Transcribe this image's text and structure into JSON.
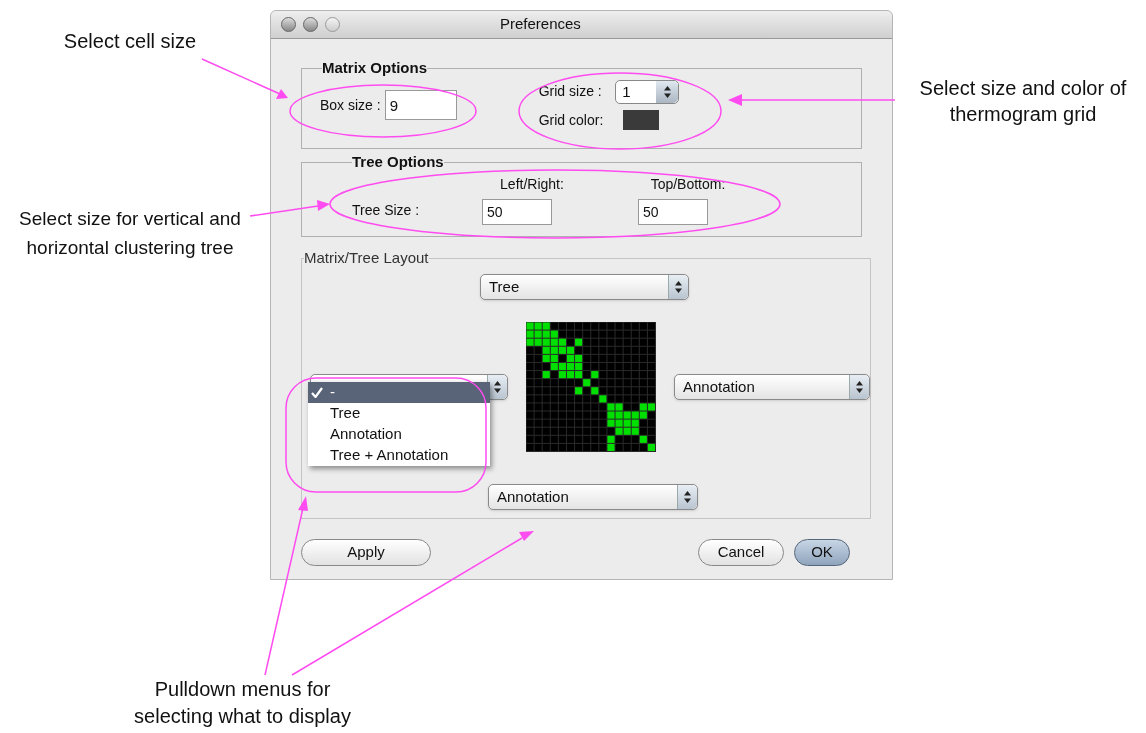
{
  "annotations": [
    {
      "text": "Select cell size"
    },
    {
      "text": "Select size and color of thermogram grid"
    },
    {
      "text": "Select size for vertical and horizontal clustering tree"
    },
    {
      "text": "Pulldown menus for selecting what to display"
    }
  ],
  "window": {
    "title": "Preferences"
  },
  "matrix_options": {
    "title": "Matrix Options",
    "box_size": {
      "label": "Box size :",
      "value": "9"
    },
    "grid_size": {
      "label": "Grid size :",
      "value": "1"
    },
    "grid_color": {
      "label": "Grid color:",
      "color": "#3a3a3a"
    }
  },
  "tree_options": {
    "title": "Tree Options",
    "row_label": "Tree Size :",
    "fields": [
      {
        "label": "Left/Right:",
        "value": "50"
      },
      {
        "label": "Top/Bottom:",
        "value": "50"
      }
    ]
  },
  "layout": {
    "title": "Matrix/Tree Layout",
    "top_popup": "Tree",
    "right_popup": "Annotation",
    "bottom_popup": "Annotation",
    "left_menu": [
      {
        "label": "-",
        "selected": true
      },
      {
        "label": "Tree",
        "selected": false
      },
      {
        "label": "Annotation",
        "selected": false
      },
      {
        "label": "Tree + Annotation",
        "selected": false
      }
    ]
  },
  "buttons": [
    {
      "label": "Apply",
      "default": false
    },
    {
      "label": "Cancel",
      "default": false
    },
    {
      "label": "OK",
      "default": true
    }
  ]
}
